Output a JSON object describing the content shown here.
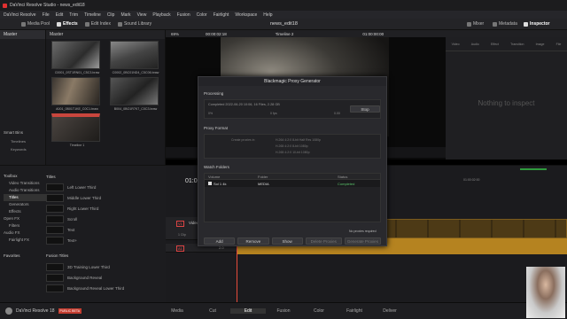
{
  "window_title": "DaVinci Resolve Studio - news_edit18",
  "menu": [
    "DaVinci Resolve",
    "File",
    "Edit",
    "Trim",
    "Timeline",
    "Clip",
    "Mark",
    "View",
    "Playback",
    "Fusion",
    "Color",
    "Fairlight",
    "Workspace",
    "Help"
  ],
  "toolbar": {
    "media_pool": "Media Pool",
    "effects": "Effects",
    "edit_index": "Edit Index",
    "sound_library": "Sound Library",
    "project_name": "news_edit18",
    "mixer": "Mixer",
    "metadata": "Metadata",
    "inspector": "Inspector"
  },
  "media_pool": {
    "bin_label": "Master",
    "master_header": "Master",
    "clips": [
      {
        "name": "C0001_0ST1RN01_C5C3.braw"
      },
      {
        "name": "C0002_0BC01ND4_C5C06.braw"
      },
      {
        "name": "A001_0B01T1KE_C0C1.braw"
      },
      {
        "name": "B004_0BO1R7K7_C0C3.braw"
      },
      {
        "name": "Timeline 1"
      }
    ],
    "smart_bins_label": "Smart Bins",
    "smart_bins": [
      "Timelines",
      "Keywords"
    ]
  },
  "viewer": {
    "zoom": "69%",
    "timecode_left": "00:00:02:18",
    "timeline_name": "Timeline 2",
    "timecode_right": "01:00:00:00"
  },
  "inspector": {
    "tabs": [
      "Video",
      "Audio",
      "Effect",
      "Transition",
      "Image",
      "File"
    ],
    "empty_text": "Nothing to inspect"
  },
  "effects": {
    "toolbox_label": "Toolbox",
    "tree": [
      "Video Transitions",
      "Audio Transitions",
      "Titles",
      "Generators",
      "Effects",
      "Open FX",
      "Filters",
      "Audio FX",
      "Fairlight FX"
    ],
    "favorites": "Favorites",
    "titles_header": "Titles",
    "titles": [
      "Left Lower Third",
      "Middle Lower Third",
      "Right Lower Third",
      "Scroll",
      "Text",
      "Text+"
    ],
    "fusion_header": "Fusion Titles",
    "fusion_titles": [
      "3D Training Lower Third",
      "Background Reveal",
      "Background Reveal Lower Third"
    ]
  },
  "timeline": {
    "timecode": "01:00:00:00",
    "ruler_mark": "01:00:02:00",
    "video_track": "V1",
    "video_track_name": "Video 1",
    "audio_track": "A1",
    "clip_count": "1 Clip",
    "volume_db": "2.0"
  },
  "dialog": {
    "title": "Blackmagic Proxy Generator",
    "processing_label": "Processing",
    "processing_status": "Completed 2022-06-20 10:06, 16 Files, 2.28 GB",
    "progress_left": "0%",
    "progress_fps": "0 fps",
    "progress_right": "0.00",
    "stop_label": "Stop",
    "proxy_format_label": "Proxy Format",
    "codec_label": "Create proxies in",
    "formats": [
      "H.264 4:2:0 8-bit Half Res 1080p",
      "H.265 4:2:0 8-bit 1080p",
      "H.265 4:2:0 10-bit 1080p"
    ],
    "watch_folders_label": "Watch Folders",
    "columns": [
      "Volume",
      "Folder",
      "Status"
    ],
    "rows": [
      {
        "volume": "Sol 1 4k",
        "folder": "MEDIA",
        "status": "Completed"
      }
    ],
    "buttons": [
      "Add",
      "Remove",
      "Show",
      "Delete Proxies",
      "Generate Proxies"
    ],
    "proxies_required": "No proxies required"
  },
  "pages": [
    "Media",
    "Cut",
    "Edit",
    "Fusion",
    "Color",
    "Fairlight",
    "Deliver"
  ],
  "active_page": "Edit",
  "app_name": "DaVinci Resolve 18",
  "public_beta": "PUBLIC BETA",
  "colors": {
    "accent": "#e64b3c",
    "clip_audio": "#b58320",
    "completed": "#59c26a"
  }
}
